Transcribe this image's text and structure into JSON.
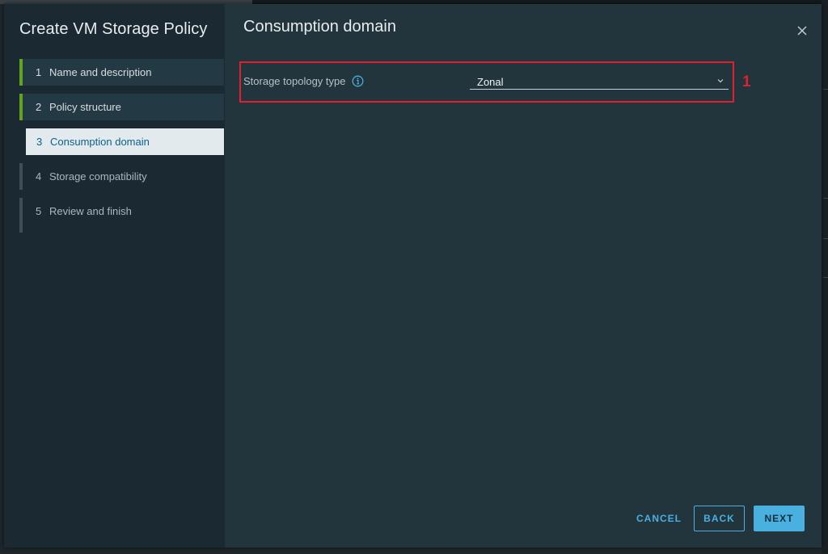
{
  "dialog": {
    "title": "Create VM Storage Policy"
  },
  "steps": [
    {
      "num": "1",
      "label": "Name and description",
      "state": "done"
    },
    {
      "num": "2",
      "label": "Policy structure",
      "state": "done"
    },
    {
      "num": "3",
      "label": "Consumption domain",
      "state": "active"
    },
    {
      "num": "4",
      "label": "Storage compatibility",
      "state": "pending"
    },
    {
      "num": "5",
      "label": "Review and finish",
      "state": "pending"
    }
  ],
  "page": {
    "title": "Consumption domain",
    "close_icon": "close-icon"
  },
  "form": {
    "topology_label": "Storage topology type",
    "info_icon": "info-icon",
    "topology_value": "Zonal",
    "callout": "1"
  },
  "footer": {
    "cancel": "CANCEL",
    "back": "BACK",
    "next": "NEXT"
  },
  "colors": {
    "accent": "#49b0e0",
    "done_bar": "#62a420",
    "highlight": "#e0202e"
  }
}
